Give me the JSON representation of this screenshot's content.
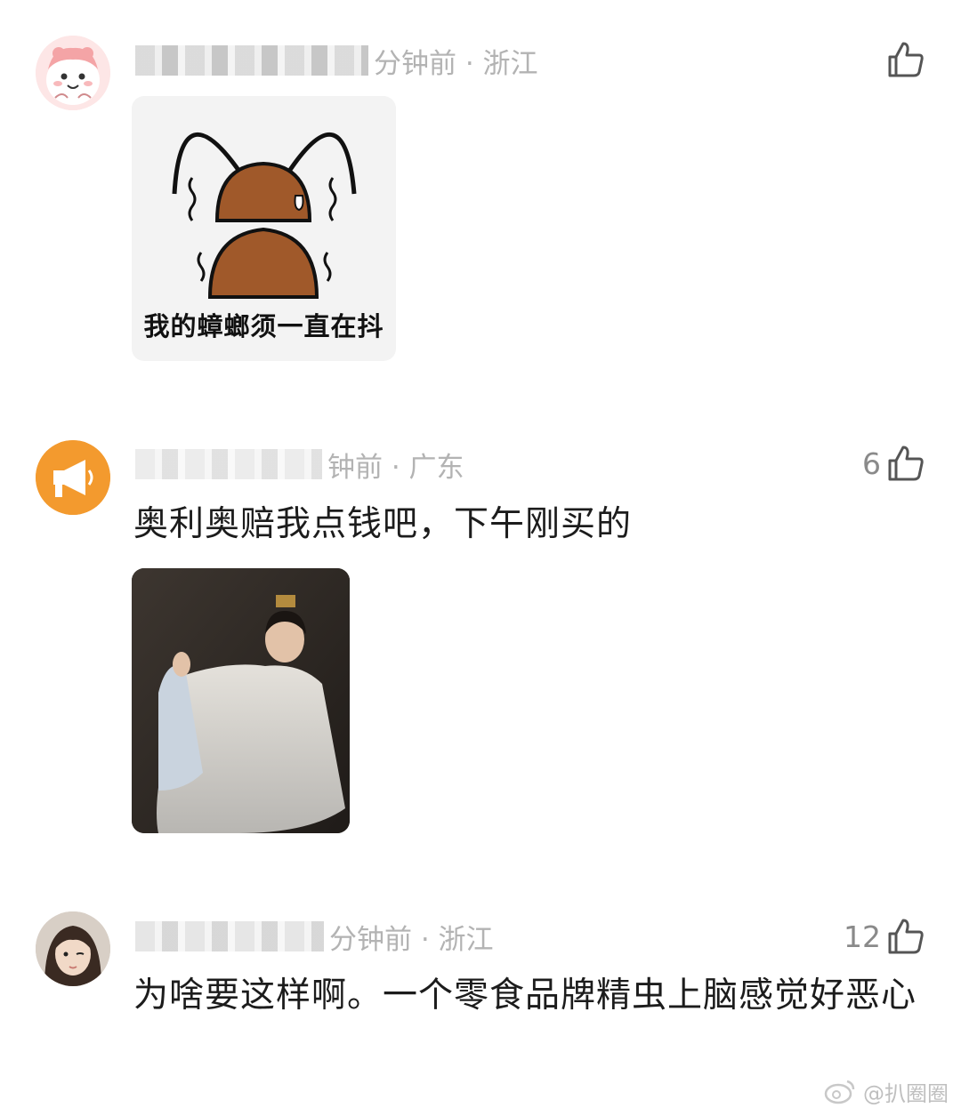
{
  "comments": [
    {
      "meta_text": "分钟前 · 浙江",
      "like_count": "",
      "text": "",
      "avatar": "pink-cartoon-avatar",
      "meme_caption": "我的蟑螂须一直在抖"
    },
    {
      "meta_text": "钟前 · 广东",
      "like_count": "6",
      "text": "奥利奥赔我点钱吧，下午刚买的",
      "avatar": "orange-megaphone-avatar",
      "image": "drama-still-photo"
    },
    {
      "meta_text": "分钟前 · 浙江",
      "like_count": "12",
      "text": "为啥要这样啊。一个零食品牌精虫上脑感觉好恶心",
      "avatar": "girl-photo-avatar"
    }
  ],
  "watermark": {
    "text": "@扒圈圈",
    "icon": "weibo-icon"
  },
  "colors": {
    "meta": "#b3b3b3",
    "text": "#1c1c1c",
    "like": "#8a8a8a",
    "orange_avatar": "#f39a2e"
  }
}
